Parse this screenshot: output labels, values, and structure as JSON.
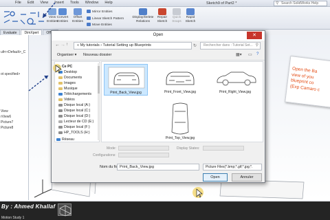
{
  "app": {
    "menu": [
      "File",
      "Edit",
      "View",
      "Insert",
      "Tools",
      "Window",
      "Help"
    ],
    "doc_title": "Sketch9 of Part2 *",
    "search_placeholder": "Search SolidWorks Help"
  },
  "ribbon": {
    "linear_pattern_label": "View\nEntities",
    "convert_label": "Convert\nEntities",
    "offset_label": "Offset\nEntities",
    "mirror_label": "Mirror Entities",
    "linear_sketch_label": "Linear Sketch Pattern",
    "move_label": "Move Entities",
    "display_delete_label": "Display/Delete\nRelations",
    "repair_label": "Repair\nSketch",
    "quick_snaps_label": "Quick\nSnaps",
    "rapid_sketch_label": "Rapid\nSketch"
  },
  "tabs": [
    "Evaluate",
    "DimXpert",
    "Office"
  ],
  "sidebar": {
    "items": [
      "ult<<Default>_C",
      "ot specified>",
      "View",
      "rView6",
      "Picture7",
      "Picture8"
    ]
  },
  "callout": {
    "text": "Open the Ba\nview of you\nblueprint co\n(Exp Camaro c"
  },
  "status": {
    "credit": "By : Ahmed Khallaf",
    "motion_tab": "Motion Study 1"
  },
  "dialog": {
    "title": "Open",
    "close_glyph": "✕",
    "breadcrumb": "«  My tutorials  ›  Tutorial Setting up Blueprints",
    "search_placeholder": "Rechercher dans : Tutorial Set...",
    "organize": "Organiser ▾",
    "new_folder": "Nouveau dossier",
    "nav_items": [
      "Ce PC",
      "Desktop",
      "Documents",
      "Images",
      "Musique",
      "Téléchargements",
      "Vidéos",
      "Disque local (A:)",
      "Disque local (C:)",
      "Disque local (D:)",
      "Lecteur de CD (E:)",
      "Disque local (F:)",
      "HP_TOOLS (H:)",
      "Réseau"
    ],
    "files": [
      {
        "name": "Print_Back_View.jpg",
        "selected": true
      },
      {
        "name": "Print_Front_View.jpg",
        "selected": false
      },
      {
        "name": "Print_Right_View.jpg",
        "selected": false
      },
      {
        "name": "Print_Top_View.jpg",
        "selected": false
      }
    ],
    "mode_label": "Mode:",
    "display_states_label": "Display States:",
    "configurations_label": "Configurations:",
    "filename_label": "Nom du fichier :",
    "filename_value": "Print_Back_View.jpg",
    "filter_value": "Picture Files(*.bmp;*.gif;*.jpg;*.",
    "open_button": "Open",
    "cancel_button": "Annuler"
  },
  "colors": {
    "callout_text": "#e34a12",
    "selection": "#cce8ff",
    "close_button": "#c7352b"
  }
}
